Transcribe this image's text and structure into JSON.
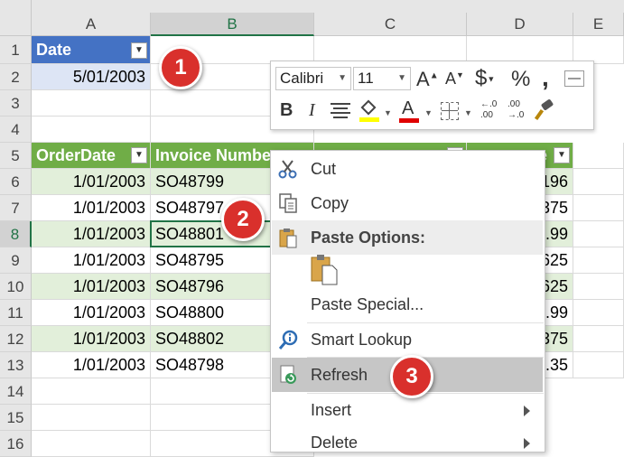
{
  "columns": [
    "A",
    "B",
    "C",
    "D",
    "E"
  ],
  "rows": [
    "1",
    "2",
    "3",
    "4",
    "5",
    "6",
    "7",
    "8",
    "9",
    "10",
    "11",
    "12",
    "13",
    "14",
    "15",
    "16"
  ],
  "cells": {
    "a1": "Date",
    "a2": "5/01/2003",
    "a5": "OrderDate",
    "b5": "Invoice Numbe",
    "d5_tail": "e",
    "orders": [
      {
        "date": "1/01/2003",
        "invoice": "SO48799",
        "tail": "196"
      },
      {
        "date": "1/01/2003",
        "invoice": "SO48797",
        "tail": "375"
      },
      {
        "date": "1/01/2003",
        "invoice": "SO48801",
        "tail": ".99"
      },
      {
        "date": "1/01/2003",
        "invoice": "SO48795",
        "tail": "625"
      },
      {
        "date": "1/01/2003",
        "invoice": "SO48796",
        "tail": "625"
      },
      {
        "date": "1/01/2003",
        "invoice": "SO48800",
        "tail": ".99"
      },
      {
        "date": "1/01/2003",
        "invoice": "SO48802",
        "tail": "375"
      },
      {
        "date": "1/01/2003",
        "invoice": "SO48798",
        "tail": ".35"
      }
    ]
  },
  "mini_toolbar": {
    "font_name": "Calibri",
    "font_size": "11",
    "currency_icon": "$",
    "percent_icon": "%",
    "comma_icon": ",",
    "bold": "B",
    "italic": "I",
    "font_color_icon": "A",
    "inc_decimal": "←.0\n.00",
    "dec_decimal": ".00\n→.0"
  },
  "context_menu": {
    "cut": "Cut",
    "copy": "Copy",
    "paste_options": "Paste Options:",
    "paste_special": "Paste Special...",
    "smart_lookup": "Smart Lookup",
    "refresh": "Refresh",
    "insert": "Insert",
    "delete": "Delete"
  },
  "badges": [
    "1",
    "2",
    "3"
  ],
  "colors": {
    "table_header_green": "#70ad47",
    "table_band_green": "#e2efda",
    "date_header_blue": "#4472c4",
    "badge_red": "#d9302c",
    "highlight_gray": "#c6c6c6"
  }
}
